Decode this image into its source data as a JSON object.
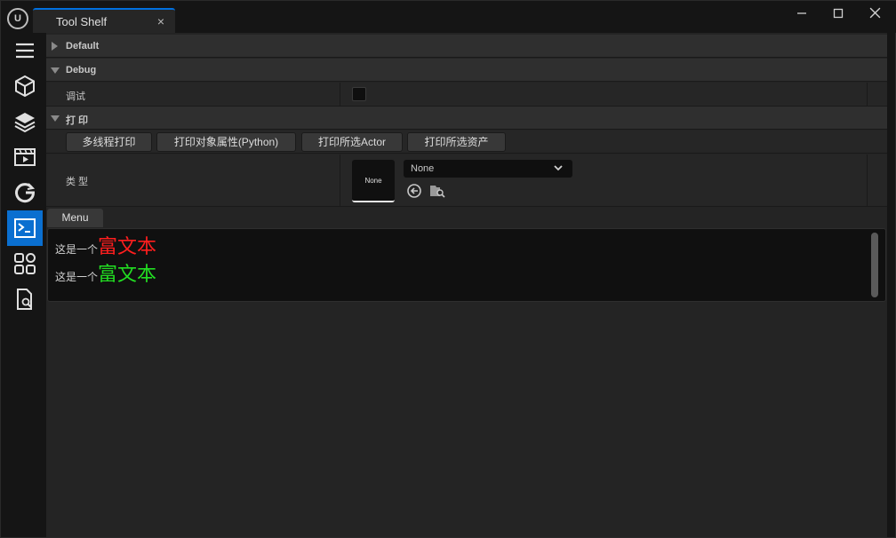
{
  "window": {
    "logo_text": "U",
    "tab_title": "Tool Shelf",
    "tab_close": "×",
    "min_glyph": "—",
    "max_glyph": "☐",
    "close_glyph": "✕"
  },
  "left_toolbar": {
    "items": [
      {
        "icon": "hamburger-menu-icon"
      },
      {
        "icon": "cube-icon"
      },
      {
        "icon": "layers-icon"
      },
      {
        "icon": "film-clapper-icon"
      },
      {
        "icon": "refresh-g-icon"
      },
      {
        "icon": "terminal-icon",
        "active": true
      },
      {
        "icon": "grid-apps-icon"
      },
      {
        "icon": "document-search-icon"
      }
    ]
  },
  "categories": {
    "default": "Default",
    "debug": "Debug",
    "print": "打 印"
  },
  "debug": {
    "label": "调试",
    "checked": false
  },
  "print_buttons": [
    "多线程打印",
    "打印对象属性(Python)",
    "打印所选Actor",
    "打印所选资产"
  ],
  "type_row": {
    "label": "类 型",
    "thumbnail_text": "None",
    "combo_value": "None",
    "browse_icon": "arrow-left-circle-icon",
    "find_icon": "folder-search-icon"
  },
  "menu_label": "Menu",
  "rich_text": {
    "lines": [
      {
        "plain": "这是一个",
        "rich": "富文本",
        "color": "#ff1e1e"
      },
      {
        "plain": "这是一个",
        "rich": "富文本",
        "color": "#22dd22"
      }
    ]
  },
  "colors": {
    "accent": "#0a6fd0",
    "panel": "#242424",
    "background": "#151515"
  }
}
